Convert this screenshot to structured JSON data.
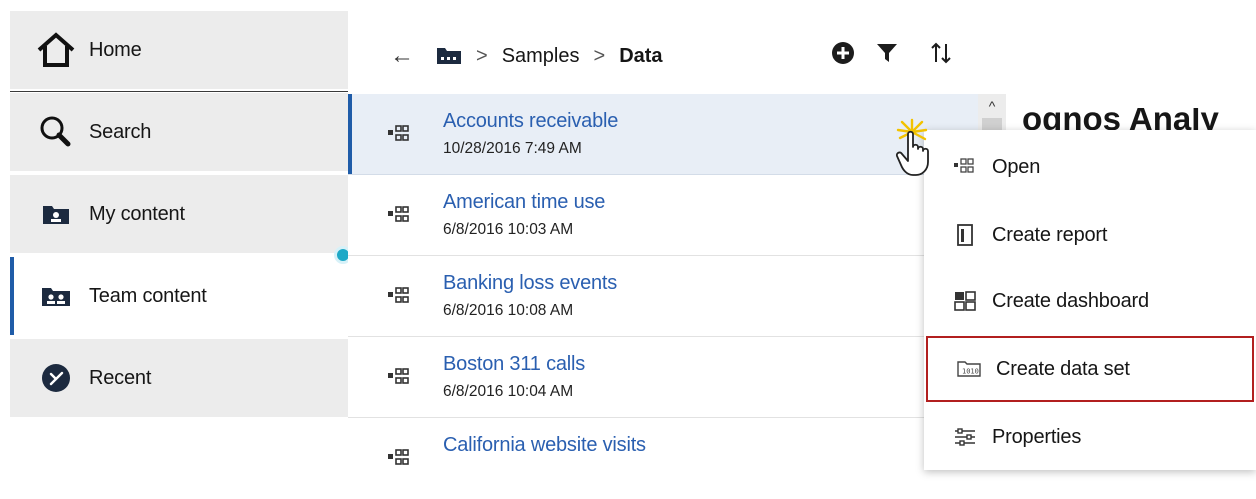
{
  "nav": {
    "items": [
      {
        "label": "Home",
        "icon": "home-icon"
      },
      {
        "label": "Search",
        "icon": "search-icon"
      },
      {
        "label": "My content",
        "icon": "my-content-icon"
      },
      {
        "label": "Team content",
        "icon": "team-content-icon"
      },
      {
        "label": "Recent",
        "icon": "recent-icon"
      }
    ],
    "active": "Team content"
  },
  "breadcrumb": {
    "items": [
      "Samples",
      "Data"
    ]
  },
  "files": [
    {
      "title": "Accounts receivable",
      "date": "10/28/2016 7:49 AM"
    },
    {
      "title": "American time use",
      "date": "6/8/2016 10:03 AM"
    },
    {
      "title": "Banking loss events",
      "date": "6/8/2016 10:08 AM"
    },
    {
      "title": "Boston 311 calls",
      "date": "6/8/2016 10:04 AM"
    },
    {
      "title": "California website visits",
      "date": ""
    }
  ],
  "context_menu": {
    "items": [
      {
        "label": "Open",
        "icon": "open-icon"
      },
      {
        "label": "Create report",
        "icon": "report-icon"
      },
      {
        "label": "Create dashboard",
        "icon": "dashboard-icon"
      },
      {
        "label": "Create data set",
        "icon": "data-set-icon"
      },
      {
        "label": "Properties",
        "icon": "properties-icon"
      }
    ],
    "highlighted": "Create data set"
  },
  "background_title": "ognos Analy",
  "colors": {
    "accent": "#1f5ca8",
    "link": "#2a5fb0",
    "highlight_border": "#b21f1f",
    "handle": "#1fa9c7"
  }
}
